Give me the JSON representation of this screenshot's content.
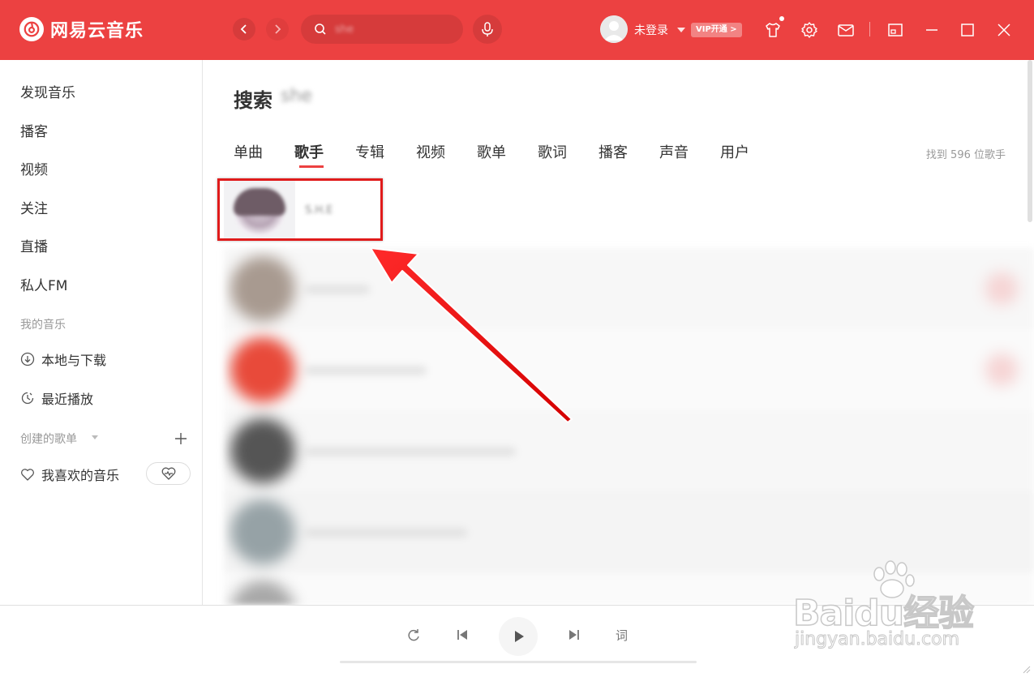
{
  "header": {
    "app_name": "网易云音乐",
    "search_query": "she",
    "user_status": "未登录",
    "vip_badge": "VIP开通 >"
  },
  "sidebar": {
    "items": [
      {
        "label": "发现音乐"
      },
      {
        "label": "播客"
      },
      {
        "label": "视频"
      },
      {
        "label": "关注"
      },
      {
        "label": "直播"
      },
      {
        "label": "私人FM"
      }
    ],
    "my_music_title": "我的音乐",
    "my_music": [
      {
        "label": "本地与下载",
        "icon": "download-icon"
      },
      {
        "label": "最近播放",
        "icon": "clock-icon"
      }
    ],
    "created_playlists_title": "创建的歌单",
    "liked_music": "我喜欢的音乐"
  },
  "main": {
    "search_label": "搜索",
    "search_query": "she",
    "tabs": [
      {
        "label": "单曲",
        "active": false
      },
      {
        "label": "歌手",
        "active": true
      },
      {
        "label": "专辑",
        "active": false
      },
      {
        "label": "视频",
        "active": false
      },
      {
        "label": "歌单",
        "active": false
      },
      {
        "label": "歌词",
        "active": false
      },
      {
        "label": "播客",
        "active": false
      },
      {
        "label": "声音",
        "active": false
      },
      {
        "label": "用户",
        "active": false
      }
    ],
    "result_count": "找到 596 位歌手",
    "first_result_name": "S.H.E"
  },
  "player": {
    "lyric_button": "词"
  },
  "watermark": {
    "title": "Baidu经验",
    "url": "jingyan.baidu.com"
  },
  "colors": {
    "brand_red": "#ec4141",
    "highlight_box": "#e01b1b"
  }
}
